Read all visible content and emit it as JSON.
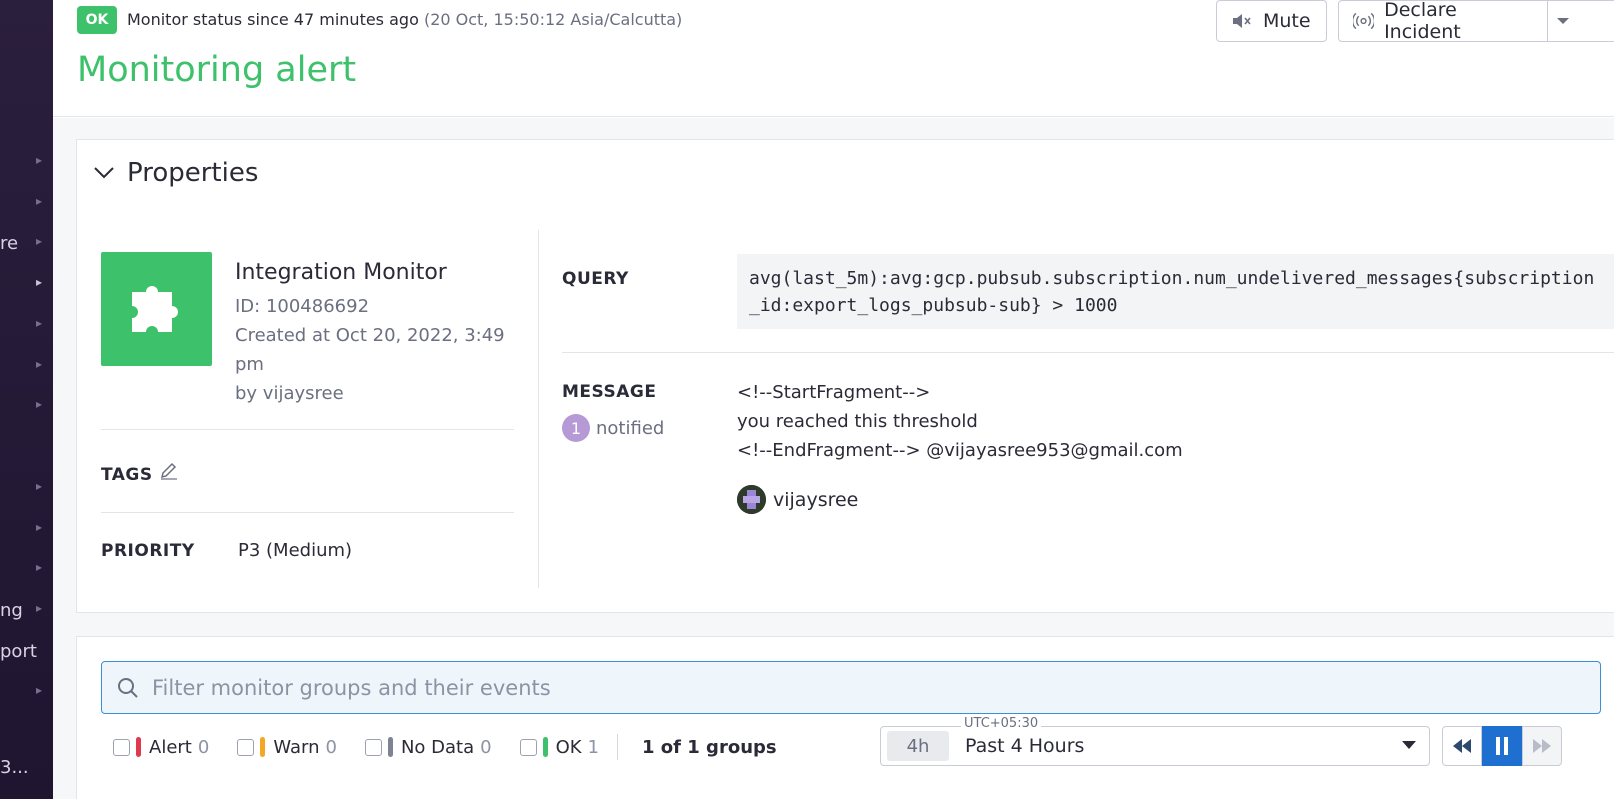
{
  "sidebar": {
    "items": [
      {
        "text": ""
      },
      {
        "text": ""
      },
      {
        "text": "re"
      },
      {
        "text": ""
      },
      {
        "text": ""
      },
      {
        "text": ""
      },
      {
        "text": ""
      },
      {
        "text": ""
      },
      {
        "text": ""
      },
      {
        "text": ""
      },
      {
        "text": "ng"
      },
      {
        "text": "port"
      },
      {
        "text": ""
      },
      {
        "text": "3..."
      }
    ]
  },
  "header": {
    "status_badge": "OK",
    "status_text": "Monitor status since 47 minutes ago",
    "status_time": "(20 Oct, 15:50:12 Asia/Calcutta)",
    "title": "Monitoring alert",
    "mute_label": "Mute",
    "declare_label": "Declare Incident"
  },
  "properties": {
    "title": "Properties",
    "monitor_name": "Integration Monitor",
    "monitor_id": "ID: 100486692",
    "created": "Created at Oct 20, 2022, 3:49 pm",
    "created_by": "by vijaysree",
    "tags_label": "TAGS",
    "priority_label": "PRIORITY",
    "priority_value": "P3 (Medium)",
    "query_label": "QUERY",
    "query": "avg(last_5m):avg:gcp.pubsub.subscription.num_undelivered_messages{subscription_id:export_logs_pubsub-sub} > 1000",
    "message_label": "MESSAGE",
    "notified_count": "1",
    "notified_label": "notified",
    "message_line1": "<!--StartFragment-->",
    "message_line2": "you reached this threshold",
    "message_line3": "<!--EndFragment--> @vijayasree953@gmail.com",
    "notified_user": "vijaysree"
  },
  "events": {
    "search_placeholder": "Filter monitor groups and their events",
    "filters": [
      {
        "label": "Alert",
        "count": "0",
        "color": "#e0384f"
      },
      {
        "label": "Warn",
        "count": "0",
        "color": "#f5a623"
      },
      {
        "label": "No Data",
        "count": "0",
        "color": "#7d8294"
      },
      {
        "label": "OK",
        "count": "1",
        "color": "#3ec16b"
      }
    ],
    "groups_text": "1 of 1 groups",
    "timezone": "UTC+05:30",
    "time_short": "4h",
    "time_label": "Past 4 Hours"
  },
  "colors": {
    "ok_green": "#3ec16b",
    "accent_blue": "#1f6fd0",
    "sidebar_bg": "#2a1f3d"
  }
}
